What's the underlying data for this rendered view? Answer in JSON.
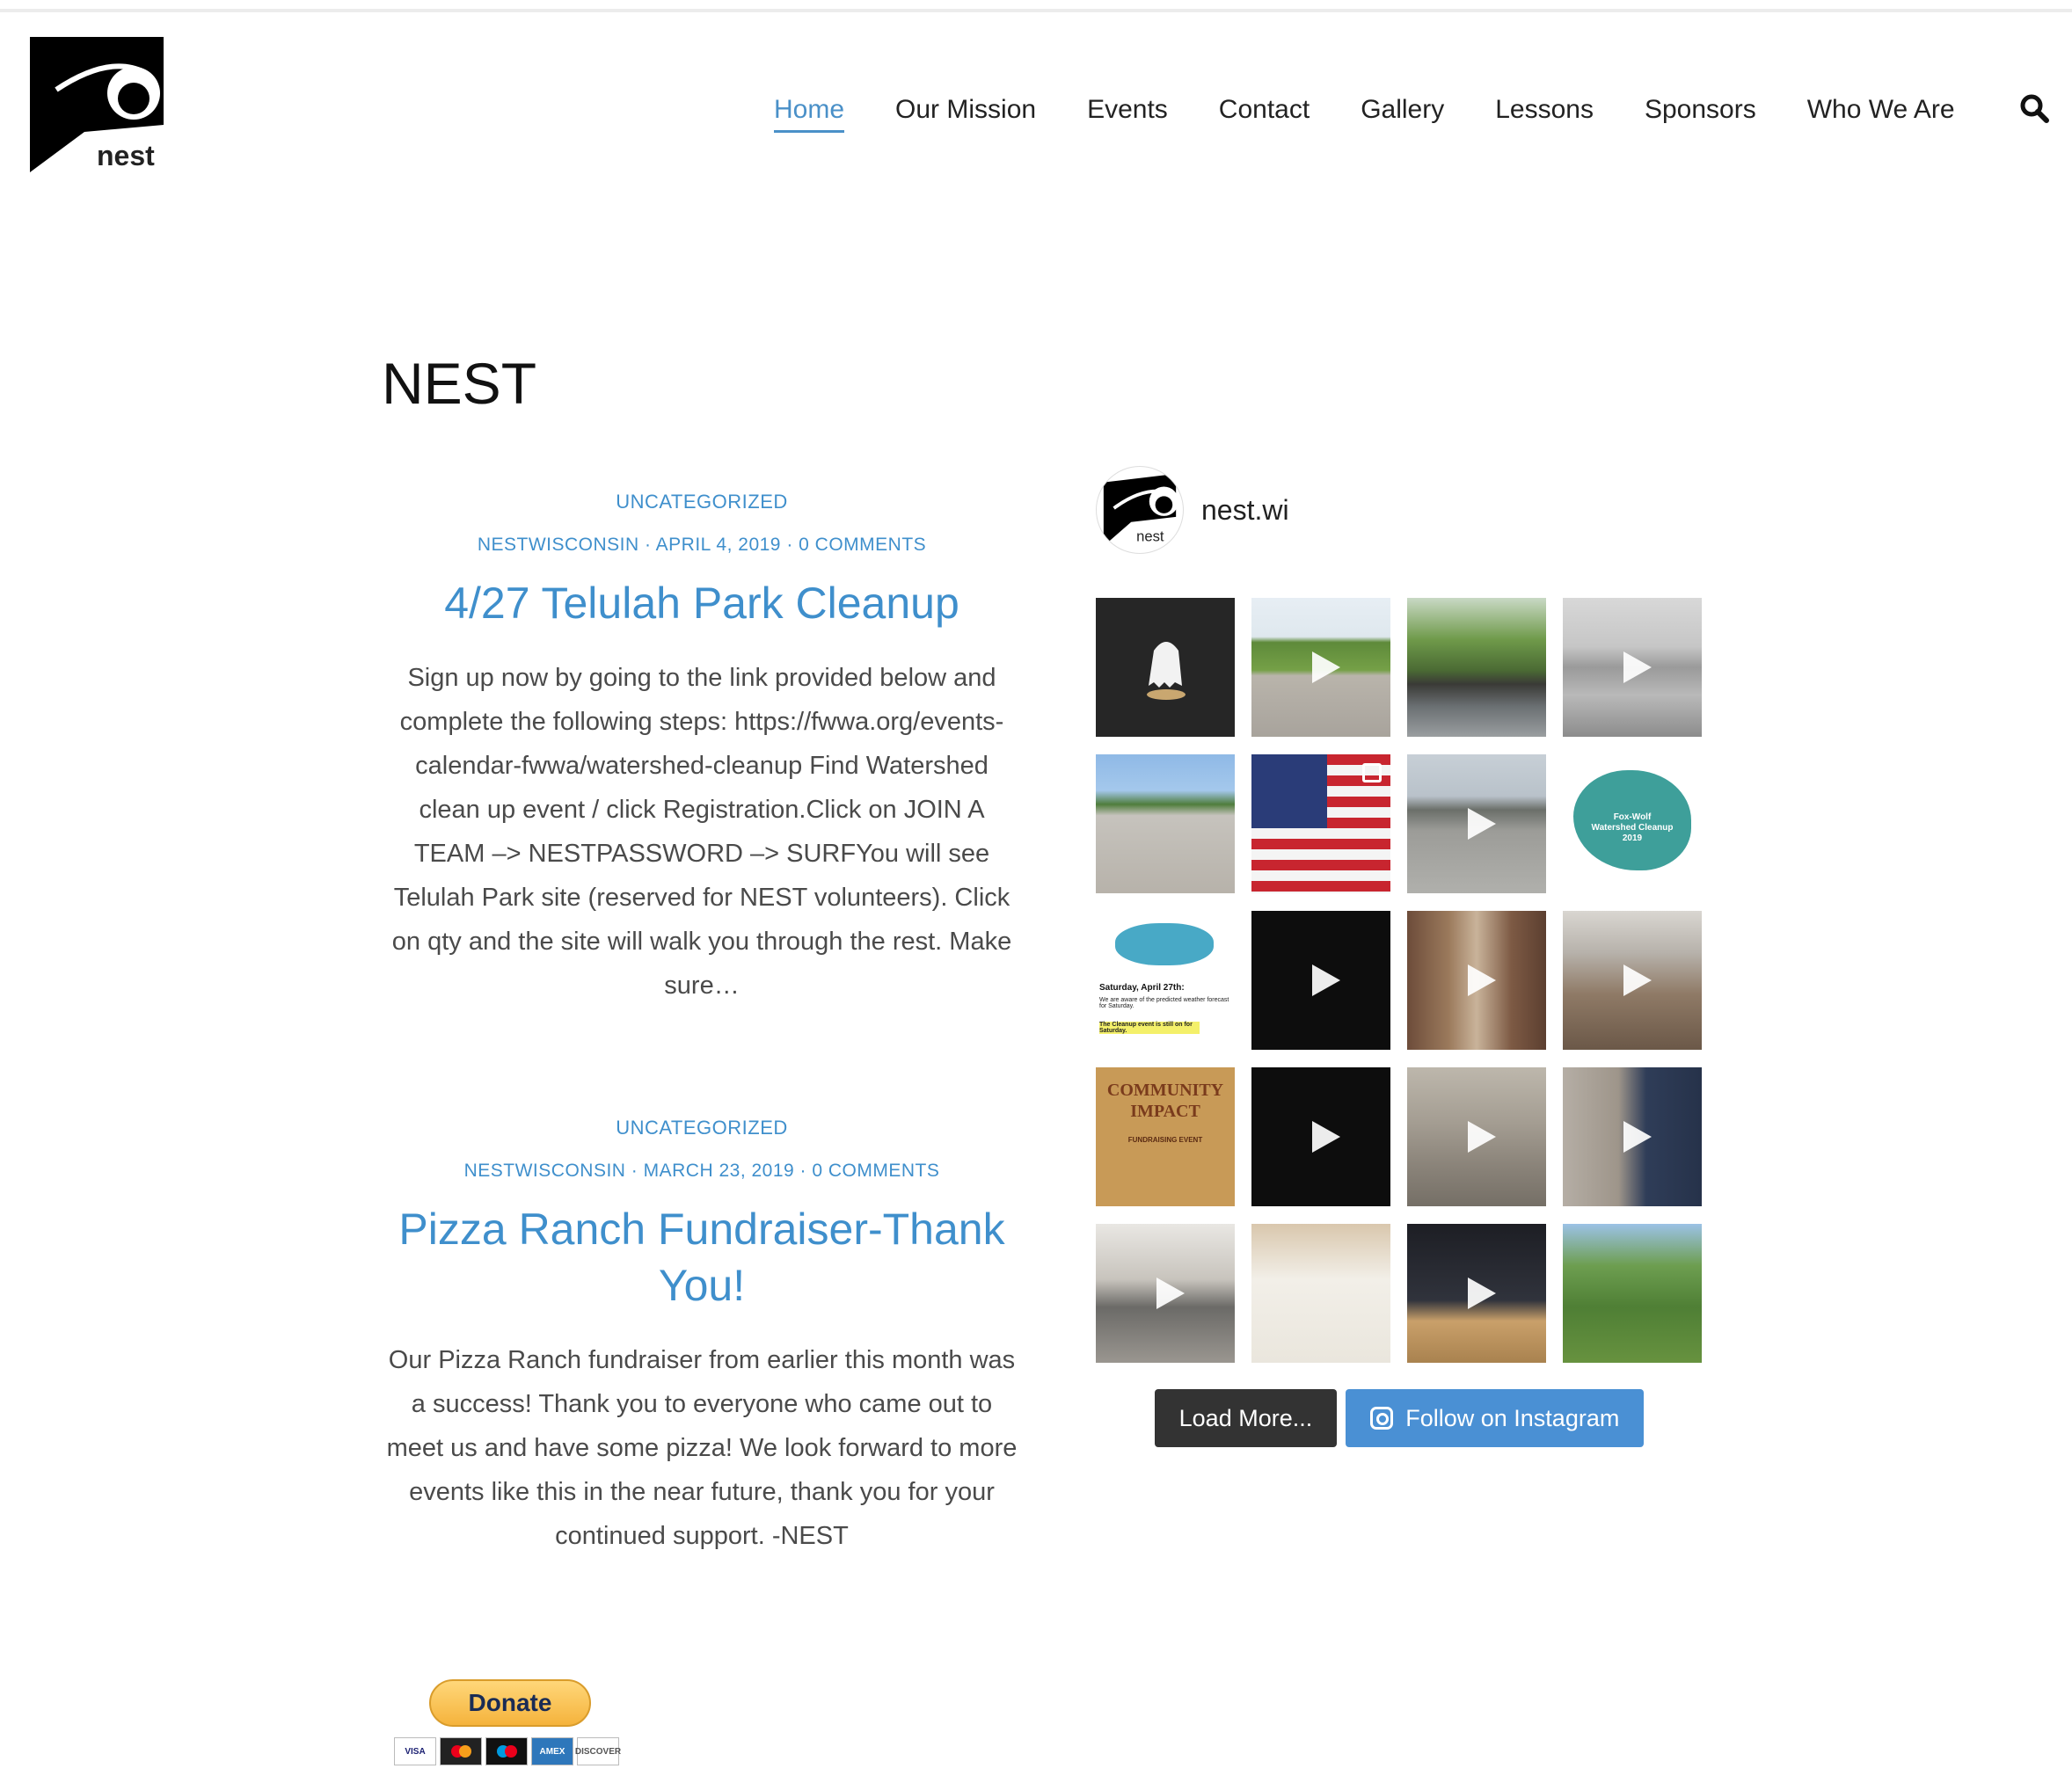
{
  "brand": {
    "logo_text": "nest"
  },
  "nav": {
    "items": [
      {
        "label": "Home",
        "active": true
      },
      {
        "label": "Our Mission",
        "active": false
      },
      {
        "label": "Events",
        "active": false
      },
      {
        "label": "Contact",
        "active": false
      },
      {
        "label": "Gallery",
        "active": false
      },
      {
        "label": "Lessons",
        "active": false
      },
      {
        "label": "Sponsors",
        "active": false
      },
      {
        "label": "Who We Are",
        "active": false
      }
    ],
    "search_icon": "search-icon"
  },
  "page": {
    "title": "NEST"
  },
  "posts": [
    {
      "category": "UNCATEGORIZED",
      "author": "NESTWISCONSIN",
      "date": "APRIL 4, 2019",
      "comments": "0 COMMENTS",
      "title": "4/27 Telulah Park Cleanup",
      "excerpt": "Sign up now by going to the link provided below and complete the following steps: https://fwwa.org/events-calendar-fwwa/watershed-cleanup Find Watershed clean up event / click Registration.Click on JOIN A TEAM –> NESTPASSWORD –> SURFYou will see Telulah Park site (reserved for NEST volunteers).  Click on qty and the site will walk you through the rest. Make sure…"
    },
    {
      "category": "UNCATEGORIZED",
      "author": "NESTWISCONSIN",
      "date": "MARCH 23, 2019",
      "comments": "0 COMMENTS",
      "title": "Pizza Ranch Fundraiser-Thank You!",
      "excerpt": "Our Pizza Ranch fundraiser from earlier this month was a success! Thank you to everyone who came out to meet us and have some pizza! We look forward to more events like this in the near future, thank you for your continued support. -NEST"
    }
  ],
  "separator": " · ",
  "donate": {
    "button_label": "Donate",
    "cards": [
      "VISA",
      "",
      "",
      "AMEX",
      "DISCOVER"
    ]
  },
  "instagram": {
    "handle": "nest.wi",
    "avatar_text": "nest",
    "tiles": [
      {
        "kind": "image"
      },
      {
        "kind": "video"
      },
      {
        "kind": "image"
      },
      {
        "kind": "video"
      },
      {
        "kind": "image"
      },
      {
        "kind": "carousel"
      },
      {
        "kind": "video"
      },
      {
        "kind": "image"
      },
      {
        "kind": "image"
      },
      {
        "kind": "video"
      },
      {
        "kind": "video"
      },
      {
        "kind": "video"
      },
      {
        "kind": "image"
      },
      {
        "kind": "video"
      },
      {
        "kind": "video"
      },
      {
        "kind": "video"
      },
      {
        "kind": "video"
      },
      {
        "kind": "image"
      },
      {
        "kind": "video"
      },
      {
        "kind": "image"
      }
    ],
    "tile_texts": {
      "cleanup_title": "Fox-Wolf\nWatershed Cleanup\n2019",
      "flyer_heading": "Saturday, April 27th:",
      "flyer_body": "We are aware of the predicted weather forecast for Saturday.",
      "flyer_note": "The Cleanup event is still on for Saturday.",
      "impact_title": "COMMUNITY IMPACT",
      "impact_sub": "FUNDRAISING EVENT"
    },
    "load_more_label": "Load More...",
    "follow_label": "Follow on Instagram"
  }
}
